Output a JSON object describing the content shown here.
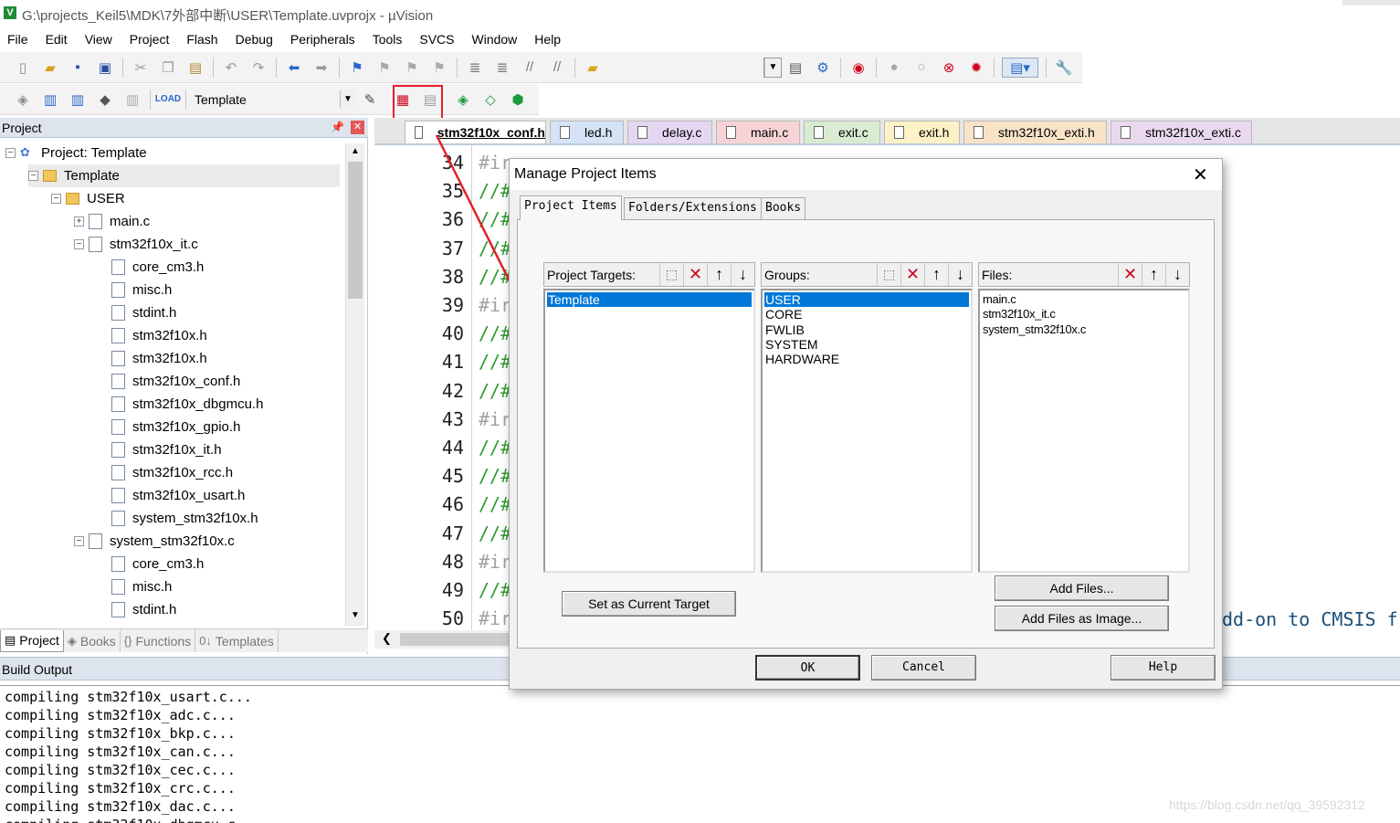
{
  "window": {
    "title": "G:\\projects_Keil5\\MDK\\7外部中断\\USER\\Template.uvprojx - µVision"
  },
  "menu": [
    "File",
    "Edit",
    "View",
    "Project",
    "Flash",
    "Debug",
    "Peripherals",
    "Tools",
    "SVCS",
    "Window",
    "Help"
  ],
  "toolbar2": {
    "target": "Template"
  },
  "project_panel": {
    "title": "Project",
    "tree": [
      {
        "label": "Project: Template",
        "indent": 0,
        "icon": "project-icon",
        "expander": "−"
      },
      {
        "label": "Template",
        "indent": 1,
        "icon": "folder-icon",
        "expander": "−",
        "selected": true
      },
      {
        "label": "USER",
        "indent": 2,
        "icon": "folder-icon",
        "expander": "−"
      },
      {
        "label": "main.c",
        "indent": 3,
        "icon": "file-icon",
        "expander": "+"
      },
      {
        "label": "stm32f10x_it.c",
        "indent": 3,
        "icon": "file-icon",
        "expander": "−"
      },
      {
        "label": "core_cm3.h",
        "indent": 4,
        "icon": "file-icon"
      },
      {
        "label": "misc.h",
        "indent": 4,
        "icon": "file-icon"
      },
      {
        "label": "stdint.h",
        "indent": 4,
        "icon": "file-icon"
      },
      {
        "label": "stm32f10x.h",
        "indent": 4,
        "icon": "file-icon"
      },
      {
        "label": "stm32f10x.h",
        "indent": 4,
        "icon": "file-icon"
      },
      {
        "label": "stm32f10x_conf.h",
        "indent": 4,
        "icon": "file-icon"
      },
      {
        "label": "stm32f10x_dbgmcu.h",
        "indent": 4,
        "icon": "file-icon"
      },
      {
        "label": "stm32f10x_gpio.h",
        "indent": 4,
        "icon": "file-icon"
      },
      {
        "label": "stm32f10x_it.h",
        "indent": 4,
        "icon": "file-icon"
      },
      {
        "label": "stm32f10x_rcc.h",
        "indent": 4,
        "icon": "file-icon"
      },
      {
        "label": "stm32f10x_usart.h",
        "indent": 4,
        "icon": "file-icon"
      },
      {
        "label": "system_stm32f10x.h",
        "indent": 4,
        "icon": "file-icon"
      },
      {
        "label": "system_stm32f10x.c",
        "indent": 3,
        "icon": "file-icon",
        "expander": "−"
      },
      {
        "label": "core_cm3.h",
        "indent": 4,
        "icon": "file-icon"
      },
      {
        "label": "misc.h",
        "indent": 4,
        "icon": "file-icon"
      },
      {
        "label": "stdint.h",
        "indent": 4,
        "icon": "file-icon"
      }
    ],
    "tabs": [
      {
        "label": "Project",
        "icon": "▤",
        "active": true
      },
      {
        "label": "Books",
        "icon": "◈"
      },
      {
        "label": "Functions",
        "icon": "{}"
      },
      {
        "label": "Templates",
        "icon": "0↓"
      }
    ]
  },
  "editor": {
    "tabs": [
      {
        "label": "stm32f10x_conf.h",
        "active": true,
        "color": "#ffffff"
      },
      {
        "label": "led.h",
        "color": "#d4e3f5"
      },
      {
        "label": "delay.c",
        "color": "#e5d6f2"
      },
      {
        "label": "main.c",
        "color": "#f6d4d6"
      },
      {
        "label": "exit.c",
        "color": "#d9ecd2"
      },
      {
        "label": "exit.h",
        "color": "#fdf2c6"
      },
      {
        "label": "stm32f10x_exti.h",
        "color": "#f9e3c8"
      },
      {
        "label": "stm32f10x_exti.c",
        "color": "#ead9ee"
      }
    ],
    "line_numbers": [
      "34",
      "35",
      "36",
      "37",
      "38",
      "39",
      "40",
      "41",
      "42",
      "43",
      "44",
      "45",
      "46",
      "47",
      "48",
      "49",
      "50"
    ],
    "line_prefixes": [
      "#ir",
      "//#",
      "//#",
      "//#",
      "//#",
      "#ir",
      "//#",
      "//#",
      "//#",
      "#ir",
      "//#",
      "//#",
      "//#",
      "//#",
      "#ir",
      "//#",
      "#ir"
    ],
    "trailing_text": "dd-on to CMSIS f"
  },
  "build_output": {
    "title": "Build Output",
    "lines": [
      "compiling stm32f10x_usart.c...",
      "compiling stm32f10x_adc.c...",
      "compiling stm32f10x_bkp.c...",
      "compiling stm32f10x_can.c...",
      "compiling stm32f10x_cec.c...",
      "compiling stm32f10x_crc.c...",
      "compiling stm32f10x_dac.c...",
      "compiling stm32f10x_dbgmcu.c..."
    ]
  },
  "watermark": "https://blog.csdn.net/qq_39592312",
  "dialog": {
    "title": "Manage Project Items",
    "tabs": [
      "Project Items",
      "Folders/Extensions",
      "Books"
    ],
    "targets": {
      "label": "Project Targets:",
      "items": [
        "Template"
      ],
      "selected": 0
    },
    "groups": {
      "label": "Groups:",
      "items": [
        "USER",
        "CORE",
        "FWLIB",
        "SYSTEM",
        "HARDWARE"
      ],
      "selected": 0
    },
    "files": {
      "label": "Files:",
      "items": [
        "main.c",
        "stm32f10x_it.c",
        "system_stm32f10x.c"
      ]
    },
    "buttons": {
      "set_current": "Set as Current Target",
      "add_files": "Add Files...",
      "add_files_image": "Add Files as Image...",
      "ok": "OK",
      "cancel": "Cancel",
      "help": "Help"
    }
  }
}
